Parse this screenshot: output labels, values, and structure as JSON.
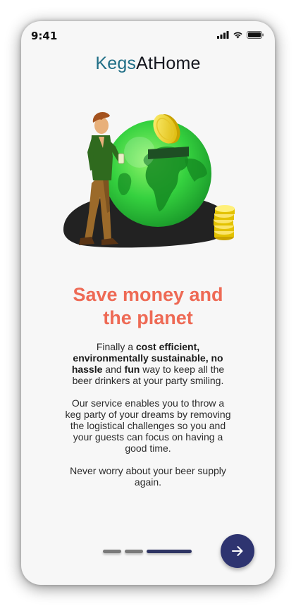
{
  "status_bar": {
    "time": "9:41",
    "icons": [
      "cellular-signal-icon",
      "wifi-icon",
      "battery-icon"
    ]
  },
  "brand": {
    "part1": "Kegs",
    "part2": "AtHome",
    "colors": {
      "part1": "#1f6e86",
      "part2": "#15171f"
    }
  },
  "hero": {
    "icon": "piggy-bank-globe-illustration"
  },
  "headline": {
    "line1": "Save money and",
    "line2": "the planet",
    "color": "#ee6a55"
  },
  "paragraph1": {
    "t1": "Finally a ",
    "b1": "cost efficient, environmentally sustainable, no hassle",
    "t2": " and ",
    "b2": "fun",
    "t3": " way to keep all the beer drinkers at your party smiling."
  },
  "paragraph2": "Our service enables you to throw a keg party of your dreams by removing the logistical challenges so you and your guests can focus on having a good time.",
  "paragraph3": "Never worry about your beer supply again.",
  "pager": {
    "page_count": 3,
    "current_page": 3
  },
  "next_button": {
    "icon": "arrow-right-icon",
    "color": "#2e3470"
  }
}
